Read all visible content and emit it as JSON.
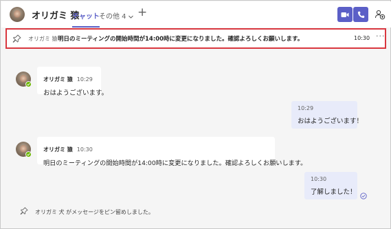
{
  "header": {
    "name": "オリガミ 猿",
    "tab_chat": "チャット",
    "tab_more": "その他 4",
    "add_tab": "+"
  },
  "pinned": {
    "author": "オリガミ 猿",
    "text": "明日のミーティングの開始時間が14:00時に変更になりました。確認よろしくお願いします。",
    "time": "10:30",
    "more": "···"
  },
  "messages": [
    {
      "direction": "in",
      "author": "オリガミ 猿",
      "time": "10:29",
      "text": "おはようございます。"
    },
    {
      "direction": "out",
      "time": "10:29",
      "text": "おはようございます！"
    },
    {
      "direction": "in",
      "author": "オリガミ 猿",
      "time": "10:30",
      "text": "明日のミーティングの開始時間が14:00時に変更になりました。確認よろしくお願いします。"
    },
    {
      "direction": "out",
      "time": "10:30",
      "text": "了解しました！"
    }
  ],
  "system": {
    "text": "オリガミ 犬 がメッセージをピン留めしました。"
  },
  "colors": {
    "accent": "#5b5fc7",
    "pinned_border": "#d9363e",
    "outgoing_bubble": "#e8ebfa",
    "presence": "#6bb700",
    "background": "#f5f5f5"
  },
  "icons": {
    "video": "video-camera-icon",
    "phone": "phone-icon",
    "people": "add-people-icon",
    "pin": "pin-icon",
    "chevron": "chevron-down-icon",
    "read": "read-receipt-icon"
  }
}
